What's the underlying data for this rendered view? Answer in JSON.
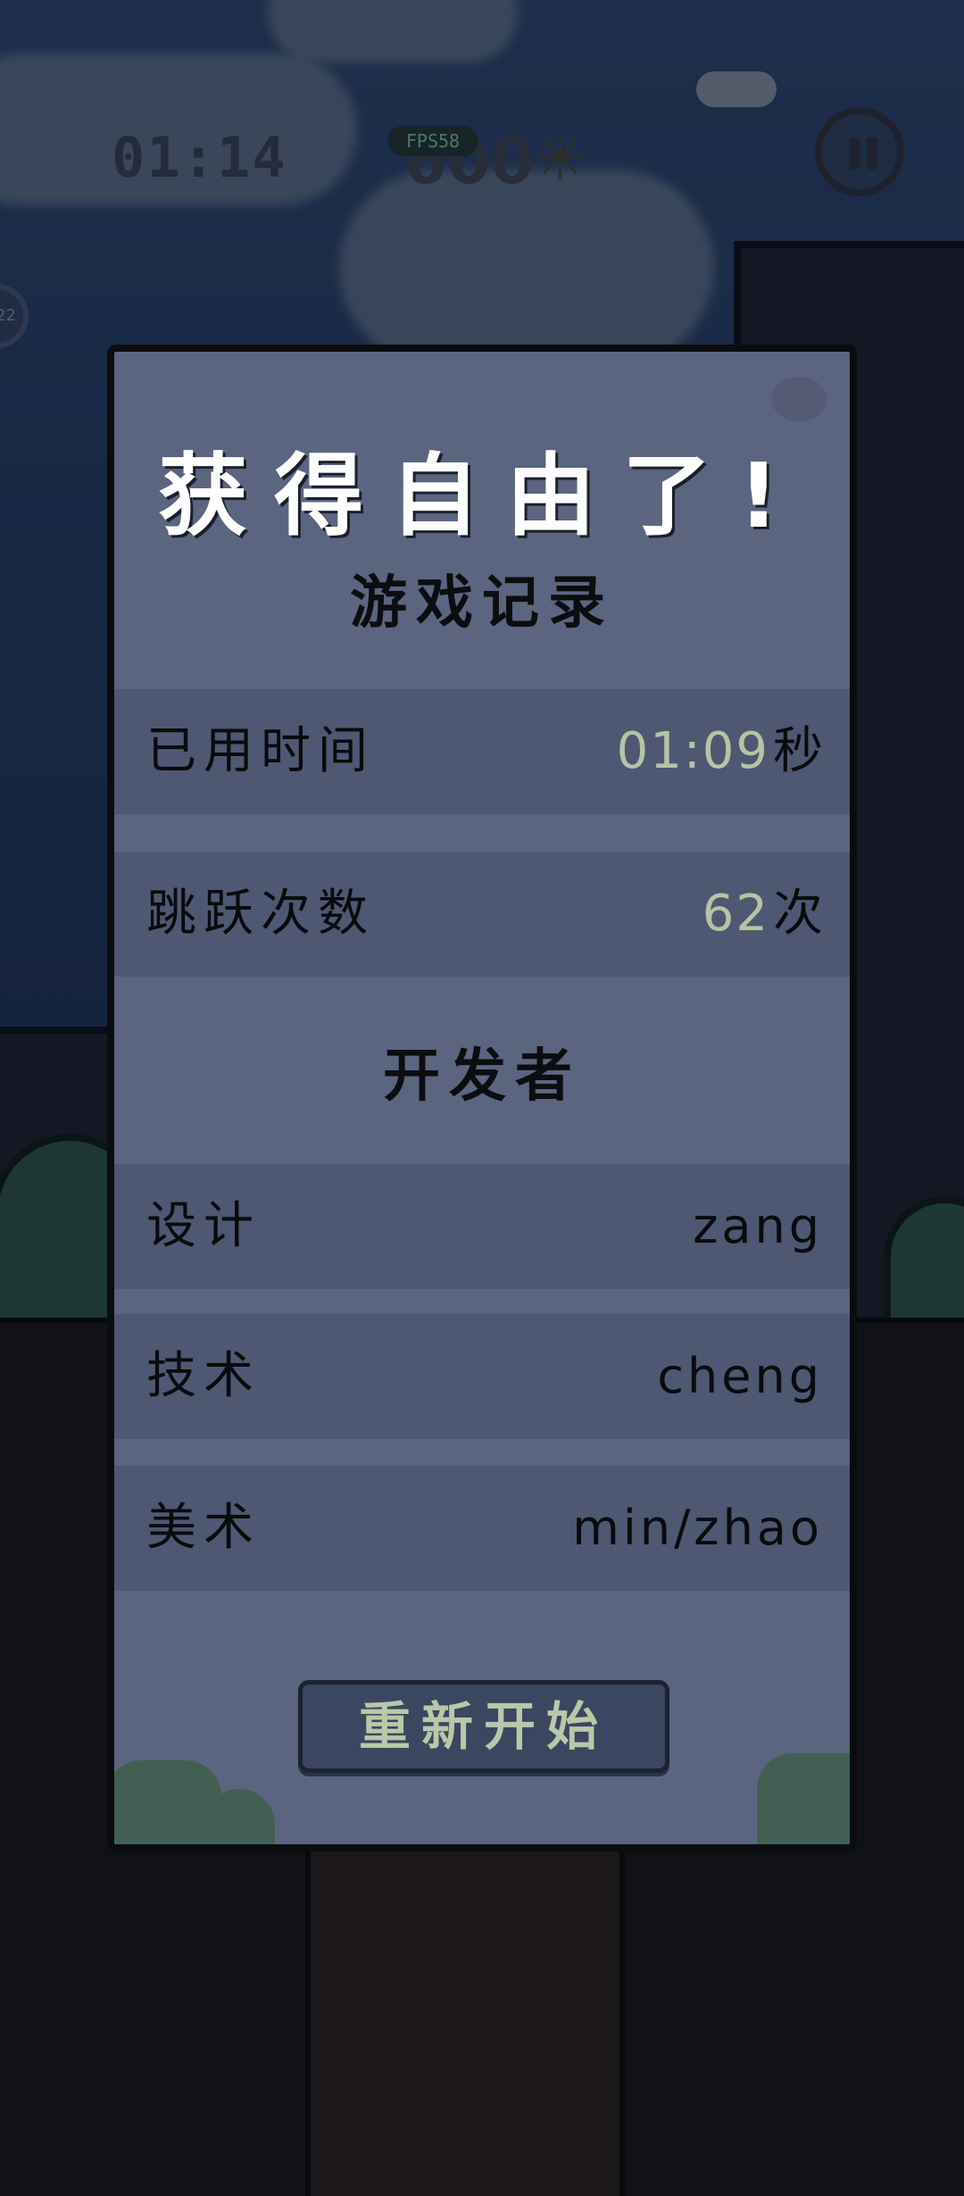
{
  "hud": {
    "time": "01:14",
    "fps": "FPS58",
    "score": "600",
    "star_icon": "✳",
    "side_badge": "22"
  },
  "panel": {
    "title": "获得自由了!",
    "record_heading": "游戏记录",
    "records": [
      {
        "label": "已用时间",
        "value": "01:09",
        "unit": "秒"
      },
      {
        "label": "跳跃次数",
        "value": "62",
        "unit": "次"
      }
    ],
    "credits_heading": "开发者",
    "credits": [
      {
        "label": "设计",
        "value": "zang"
      },
      {
        "label": "技术",
        "value": "cheng"
      },
      {
        "label": "美术",
        "value": "min/zhao"
      }
    ],
    "restart_label": "重新开始"
  },
  "colors": {
    "panel_bg": "#5b6580",
    "row_bg": "#4e5872",
    "value_accent": "#b5c4a4",
    "button_bg": "#3b4660"
  }
}
